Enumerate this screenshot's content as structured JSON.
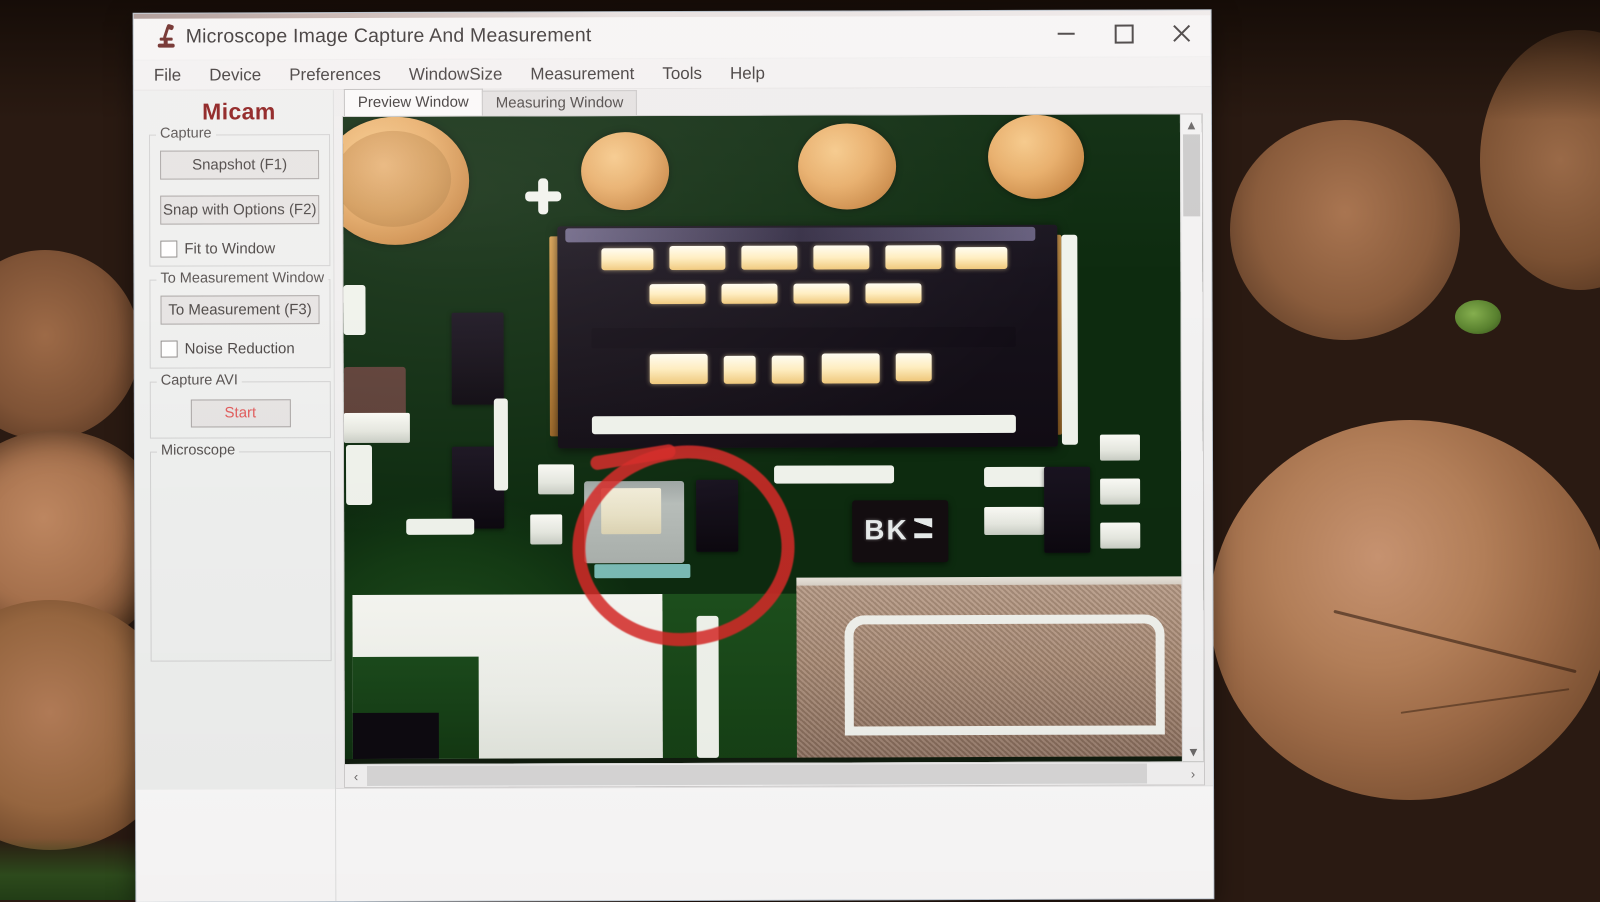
{
  "window": {
    "title": "Microscope Image Capture And Measurement",
    "icon": "microscope-icon",
    "controls": {
      "minimize": "—",
      "maximize": "□",
      "close": "✕"
    }
  },
  "menu": {
    "items": [
      {
        "label": "File"
      },
      {
        "label": "Device"
      },
      {
        "label": "Preferences"
      },
      {
        "label": "WindowSize"
      },
      {
        "label": "Measurement"
      },
      {
        "label": "Tools"
      },
      {
        "label": "Help"
      }
    ]
  },
  "sidebar": {
    "brand": "Micam",
    "brand_color": "#8b1a1a",
    "groups": [
      {
        "label": "Capture",
        "buttons": [
          {
            "label": "Snapshot (F1)"
          },
          {
            "label": "Snap with Options (F2)"
          }
        ],
        "checkboxes": [
          {
            "label": "Fit to Window",
            "checked": false
          }
        ]
      },
      {
        "label": "To Measurement Window",
        "buttons": [
          {
            "label": "To Measurement (F3)"
          }
        ],
        "checkboxes": [
          {
            "label": "Noise Reduction",
            "checked": false
          }
        ]
      },
      {
        "label": "Capture AVI",
        "buttons": [
          {
            "label": "Start",
            "color": "#e05b5b"
          }
        ],
        "checkboxes": []
      },
      {
        "label": "Microscope",
        "buttons": [],
        "checkboxes": []
      }
    ]
  },
  "tabs": [
    {
      "label": "Preview Window",
      "active": true
    },
    {
      "label": "Measuring Window",
      "active": false
    }
  ],
  "preview": {
    "subject": "printed-circuit-board-microscope-view",
    "annotation": {
      "shape": "hand-drawn-circle",
      "color": "#d62a28"
    },
    "component_marking": "BK",
    "scrollbars": {
      "vertical": {
        "up": "▲",
        "down": "▼"
      },
      "horizontal": {
        "left": "‹",
        "right": "›"
      }
    }
  },
  "desktop": {
    "wallpaper": "stacked-cut-wood-logs"
  }
}
